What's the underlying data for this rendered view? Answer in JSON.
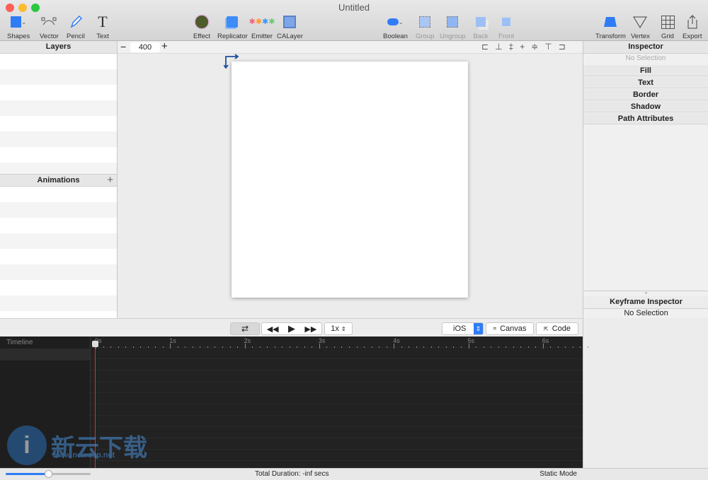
{
  "window": {
    "title": "Untitled"
  },
  "toolbar": {
    "left": [
      {
        "label": "Shapes",
        "icon": "square-shape-icon"
      },
      {
        "label": "Vector",
        "icon": "vector-path-icon"
      },
      {
        "label": "Pencil",
        "icon": "pencil-icon"
      },
      {
        "label": "Text",
        "icon": "text-icon"
      }
    ],
    "center": [
      {
        "label": "Effect",
        "icon": "effect-icon"
      },
      {
        "label": "Replicator",
        "icon": "replicator-icon"
      },
      {
        "label": "Emitter",
        "icon": "emitter-icon"
      },
      {
        "label": "CALayer",
        "icon": "calayer-icon"
      }
    ],
    "arrange": [
      {
        "label": "Boolean",
        "enabled": true
      },
      {
        "label": "Group",
        "enabled": false
      },
      {
        "label": "Ungroup",
        "enabled": false
      },
      {
        "label": "Back",
        "enabled": false
      },
      {
        "label": "Front",
        "enabled": false
      }
    ],
    "right": [
      {
        "label": "Transform"
      },
      {
        "label": "Vertex"
      },
      {
        "label": "Grid"
      },
      {
        "label": "Export"
      }
    ]
  },
  "layers": {
    "title": "Layers"
  },
  "animations": {
    "title": "Animations",
    "add": "+"
  },
  "zoom": {
    "minus": "−",
    "value": "400",
    "plus": "+"
  },
  "inspector": {
    "title": "Inspector",
    "selection": "No Selection",
    "sections": [
      "Fill",
      "Text",
      "Border",
      "Shadow",
      "Path Attributes"
    ]
  },
  "keyframe_inspector": {
    "title": "Keyframe Inspector",
    "selection": "No Selection"
  },
  "playback": {
    "speed": "1x",
    "platform": "iOS",
    "canvas": "Canvas",
    "code": "Code"
  },
  "timeline": {
    "label": "Timeline",
    "ticks": [
      "0s",
      "1s",
      "2s",
      "3s",
      "4s",
      "5s",
      "6s"
    ]
  },
  "status": {
    "duration": "Total Duration: -inf secs",
    "mode": "Static Mode",
    "zoom_slider": 0.5
  },
  "watermark": {
    "text": "新云下载",
    "url": "www.newasp.net"
  },
  "colors": {
    "accent": "#2f7cf6",
    "playhead": "#e0302a",
    "timeline_bg": "#222222"
  }
}
